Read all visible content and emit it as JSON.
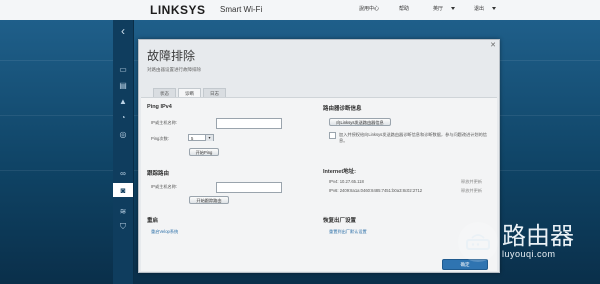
{
  "header": {
    "brand": "LINKSYS",
    "product": "Smart Wi-Fi",
    "nav": {
      "help_center": "說用中心",
      "help": "帮助",
      "language": "英厅",
      "logout": "退出"
    }
  },
  "dialog": {
    "title": "故障排除",
    "subtitle": "对路由器设置进行故障排除",
    "tabs": [
      "状态",
      "诊断",
      "日志"
    ],
    "ping": {
      "heading": "Ping IPv4",
      "ip_label": "IP或主机名称:",
      "count_label": "Ping次数:",
      "count_value": "5",
      "start_button": "开始Ping"
    },
    "traceroute": {
      "heading": "跟踪路由",
      "ip_label": "IP或主机名称:",
      "start_button": "开始跟踪路由"
    },
    "reboot": {
      "heading": "重启",
      "link": "重启Velop系统"
    },
    "diagnostics": {
      "heading": "路由器诊断信息",
      "send_button": "向Linksys发送路由器信息",
      "checkbox_text": "加入并授权给向Linksys发送路由器诊断信息和诊断数据，参与问题改进计划的信息。"
    },
    "internet": {
      "heading": "Internet地址:",
      "ipv4": "IPv4: 10.27.65.118",
      "ipv6": "IPv6: 2409:8a1a:0460:8485:7451:b0a3:8c02:2712",
      "ipv4_action": "释放并更新",
      "ipv6_action": "释放并更新"
    },
    "factory": {
      "heading": "恢复出厂设置",
      "link": "重置到出厂默认设置"
    },
    "ok_button": "确定"
  },
  "watermark": {
    "text": "路由器",
    "url": "luyouqi.com"
  }
}
